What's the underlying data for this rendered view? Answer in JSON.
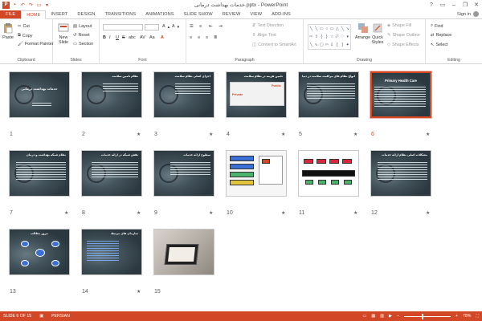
{
  "window": {
    "title": "خدمات بهداشت درمانی.pptx - PowerPoint",
    "help": "?",
    "minimize": "–",
    "restore": "❐",
    "close": "✕"
  },
  "tabs": [
    {
      "label": "FILE"
    },
    {
      "label": "HOME"
    },
    {
      "label": "INSERT"
    },
    {
      "label": "DESIGN"
    },
    {
      "label": "TRANSITIONS"
    },
    {
      "label": "ANIMATIONS"
    },
    {
      "label": "SLIDE SHOW"
    },
    {
      "label": "REVIEW"
    },
    {
      "label": "VIEW"
    },
    {
      "label": "ADD-INS"
    }
  ],
  "account": {
    "label": "Sign in"
  },
  "ribbon": {
    "clipboard": {
      "paste": "Paste",
      "cut": "Cut",
      "copy": "Copy",
      "format_painter": "Format Painter",
      "label": "Clipboard"
    },
    "slides": {
      "new_slide": "New Slide",
      "layout": "Layout",
      "reset": "Reset",
      "section": "Section",
      "label": "Slides"
    },
    "font": {
      "label": "Font",
      "bold": "B",
      "italic": "I",
      "underline": "U",
      "strike": "S",
      "shadow": "abc",
      "spacing": "AV",
      "case": "Aa",
      "color": "A"
    },
    "paragraph": {
      "text_direction": "Text Direction",
      "align_text": "Align Text",
      "convert_smartart": "Convert to SmartArt",
      "label": "Paragraph"
    },
    "drawing": {
      "arrange": "Arrange",
      "quick_styles": "Quick Styles",
      "shape_fill": "Shape Fill",
      "shape_outline": "Shape Outline",
      "shape_effects": "Shape Effects",
      "label": "Drawing"
    },
    "editing": {
      "find": "Find",
      "replace": "Replace",
      "select": "Select",
      "label": "Editing"
    }
  },
  "slides": [
    {
      "number": "1",
      "title": "خدمات بهداشت درمانی",
      "star": ""
    },
    {
      "number": "2",
      "title": "نظام تامین سلامت",
      "star": "★"
    },
    {
      "number": "3",
      "title": "اجزای اصلی نظام سلامت",
      "star": "★"
    },
    {
      "number": "4",
      "title": "تامین هزینه در نظام سلامت",
      "star": "★",
      "public": "Public",
      "private": "Private"
    },
    {
      "number": "5",
      "title": "انواع نظام های مراقبت سلامت در دنیا",
      "star": "★"
    },
    {
      "number": "6",
      "title": "Primary Health Care",
      "star": "★"
    },
    {
      "number": "7",
      "title": "نظام شبکه بهداشت و درمان",
      "star": "★"
    },
    {
      "number": "8",
      "title": "نقش شبکه در ارائه خدمات",
      "star": "★"
    },
    {
      "number": "9",
      "title": "سطوح ارائه خدمات",
      "star": "★"
    },
    {
      "number": "10",
      "title": "",
      "star": "★"
    },
    {
      "number": "11",
      "title": "",
      "star": "★"
    },
    {
      "number": "12",
      "title": "مشکلات اصلی نظام ارائه خدمات",
      "star": "★"
    },
    {
      "number": "13",
      "title": "مرور مطالب",
      "star": ""
    },
    {
      "number": "14",
      "title": "سازمان های مرتبط",
      "star": "★"
    },
    {
      "number": "15",
      "title": "",
      "star": ""
    }
  ],
  "status": {
    "slide_of": "SLIDE 6 OF 15",
    "language": "PERSIAN",
    "zoom": "78%",
    "zoom_level": 0.78
  },
  "colors": {
    "accent": "#d24726",
    "slide_dark": "#2f3d45"
  }
}
